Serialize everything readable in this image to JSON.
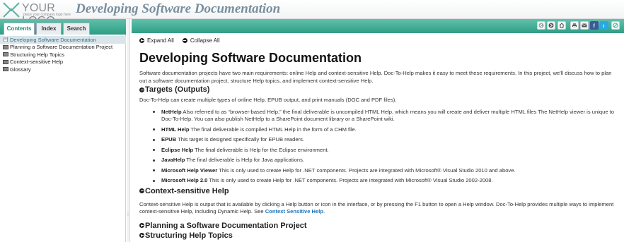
{
  "header": {
    "logo_text": "YOUR LOGO",
    "logo_subtext": "place your company logo here",
    "title": "Developing Software Documentation"
  },
  "nav": {
    "tabs": [
      {
        "label": "Contents",
        "active": true
      },
      {
        "label": "Index",
        "active": false
      },
      {
        "label": "Search",
        "active": false
      }
    ],
    "tree": [
      {
        "label": "Developing Software Documentation",
        "selected": true,
        "icon": "page-icon"
      },
      {
        "label": "Planning a Software Documentation Project",
        "selected": false,
        "icon": "book-icon"
      },
      {
        "label": "Structuring Help Topics",
        "selected": false,
        "icon": "book-icon"
      },
      {
        "label": "Context-sensitive Help",
        "selected": false,
        "icon": "book-icon"
      },
      {
        "label": "Glossary",
        "selected": false,
        "icon": "book-icon"
      }
    ]
  },
  "toolbar": {
    "buttons": [
      "back-icon",
      "forward-icon",
      "home-icon",
      "print-icon",
      "email-icon",
      "facebook-icon",
      "twitter-icon",
      "sync-toc-icon"
    ],
    "accent": "#2f9e87"
  },
  "content": {
    "expand_all": "Expand All",
    "collapse_all": "Collapse All",
    "title": "Developing Software Documentation",
    "intro": "Software documentation projects have two main requirements: online Help and context-sensitive Help. Doc-To-Help makes it easy to meet these requirements. In this project, we'll discuss how to plan out a software documentation project, structure Help topics, and implement context-sensitive Help.",
    "targets_heading": "Targets (Outputs)",
    "targets_intro": "Doc-To-Help can create multiple types of online Help, EPUB output, and print manuals (DOC and PDF files).",
    "targets": [
      {
        "term": "NetHelp",
        "desc": " Also referred to as “browser-based Help,” the final deliverable is uncompiled HTML Help, which means you will create and deliver multiple HTML files The NetHelp viewer is unique to Doc-To-Help. You can also publish NetHelp to a SharePoint document library or a SharePoint wiki."
      },
      {
        "term": "HTML Help",
        "desc": " The final deliverable is compiled HTML Help in the form of a CHM file."
      },
      {
        "term": "EPUB",
        "desc": " This target is designed specifically for EPUB readers."
      },
      {
        "term": "Eclipse Help",
        "desc": " The final deliverable is Help for the Eclipse environment."
      },
      {
        "term": "JavaHelp",
        "desc": " The final deliverable is Help for Java applications."
      },
      {
        "term": "Microsoft Help Viewer",
        "desc": " This is only used to create Help for .NET components. Projects are integrated with Microsoft® Visual Studio 2010 and above."
      },
      {
        "term": "Microsoft Help 2.0",
        "desc": " This is only used to create Help for .NET components. Projects are integrated with Microsoft® Visual Studio 2002-2008."
      }
    ],
    "csh_heading": "Context-sensitive Help",
    "csh_text": "Context-sensitive Help is output that is available by clicking a Help button or icon in the interface, or by pressing the F1 button to open a Help window. Doc-To-Help provides multiple ways to implement context-sensitive Help, including Dynamic Help. See ",
    "csh_link": "Context Sensitive Help",
    "csh_end": ".",
    "planning_heading": "Planning a Software Documentation Project",
    "structuring_heading": "Structuring Help Topics"
  }
}
